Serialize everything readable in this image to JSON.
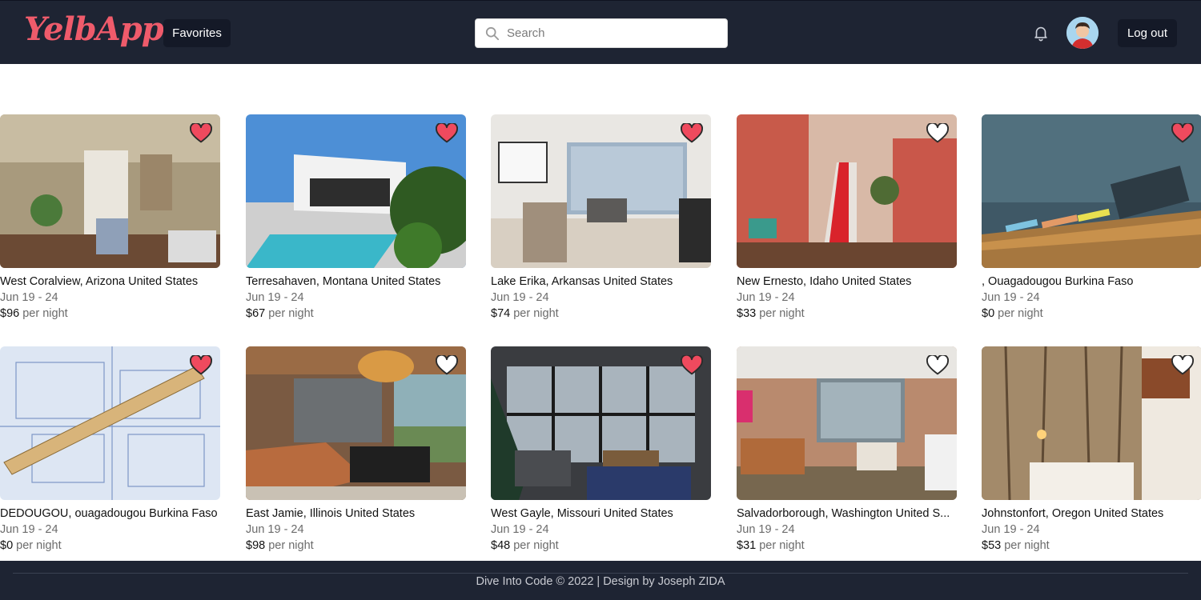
{
  "brand": {
    "logo_text": "YelbApp",
    "accent": "#ef5b6b"
  },
  "nav": {
    "favorites_label": "Favorites",
    "logout_label": "Log out"
  },
  "search": {
    "placeholder": "Search",
    "value": ""
  },
  "icons": {
    "search": "search-icon",
    "notifications": "bell-icon",
    "favorite": "heart-icon"
  },
  "listings": [
    {
      "location": "West Coralview, Arizona United States",
      "dates": "Jun 19 - 24",
      "price": "$96",
      "unit": "per night",
      "favorited": true
    },
    {
      "location": "Terresahaven, Montana United States",
      "dates": "Jun 19 - 24",
      "price": "$67",
      "unit": "per night",
      "favorited": true
    },
    {
      "location": "Lake Erika, Arkansas United States",
      "dates": "Jun 19 - 24",
      "price": "$74",
      "unit": "per night",
      "favorited": true
    },
    {
      "location": "New Ernesto, Idaho United States",
      "dates": "Jun 19 - 24",
      "price": "$33",
      "unit": "per night",
      "favorited": false
    },
    {
      "location": ", Ouagadougou Burkina Faso",
      "dates": "Jun 19 - 24",
      "price": "$0",
      "unit": "per night",
      "favorited": true
    },
    {
      "location": "DEDOUGOU, ouagadougou Burkina Faso",
      "dates": "Jun 19 - 24",
      "price": "$0",
      "unit": "per night",
      "favorited": true
    },
    {
      "location": "East Jamie, Illinois United States",
      "dates": "Jun 19 - 24",
      "price": "$98",
      "unit": "per night",
      "favorited": false
    },
    {
      "location": "West Gayle, Missouri United States",
      "dates": "Jun 19 - 24",
      "price": "$48",
      "unit": "per night",
      "favorited": true
    },
    {
      "location": "Salvadorborough, Washington United S...",
      "dates": "Jun 19 - 24",
      "price": "$31",
      "unit": "per night",
      "favorited": false
    },
    {
      "location": "Johnstonfort, Oregon United States",
      "dates": "Jun 19 - 24",
      "price": "$53",
      "unit": "per night",
      "favorited": false
    }
  ],
  "footer": {
    "text": "Dive Into Code © 2022 | Design by Joseph ZIDA"
  },
  "colors": {
    "header_bg": "#1e2433",
    "button_bg": "#141927",
    "heart_red": "#ef4a5e"
  }
}
